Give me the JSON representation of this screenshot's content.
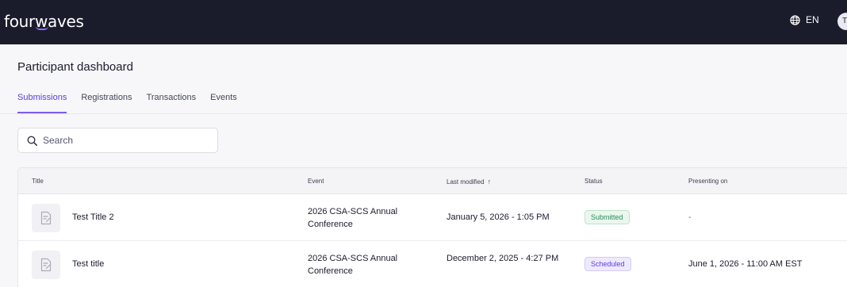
{
  "app": {
    "logo_prefix": "four",
    "logo_w": "w",
    "logo_suffix": "aves",
    "language": "EN",
    "avatar_initial": "T",
    "accent_color": "#7c5cf0",
    "topbar_color": "#1b1c2b"
  },
  "page": {
    "title": "Participant dashboard"
  },
  "tabs": [
    {
      "label": "Submissions",
      "active": true
    },
    {
      "label": "Registrations",
      "active": false
    },
    {
      "label": "Transactions",
      "active": false
    },
    {
      "label": "Events",
      "active": false
    }
  ],
  "search": {
    "placeholder": "Search",
    "value": "",
    "icon": "search-icon"
  },
  "table": {
    "columns": [
      "Title",
      "Event",
      "Last modified",
      "Status",
      "Presenting on"
    ],
    "sort_indicator": "↑",
    "rows": [
      {
        "icon": "document-icon",
        "title": "Test Title 2",
        "event": "2026 CSA-SCS Annual Conference",
        "last_modified": "January 5, 2026 - 1:05 PM",
        "status": "Submitted",
        "presenting_on": "-"
      },
      {
        "icon": "document-icon",
        "title": "Test title",
        "event": "2026 CSA-SCS Annual Conference",
        "last_modified": "December 2, 2025 - 4:27 PM",
        "status": "Scheduled",
        "presenting_on": "June 1, 2026 - 11:00 AM EST"
      }
    ]
  },
  "status_colors": {
    "submitted": "#2e8b57",
    "scheduled": "#5b3ee0"
  }
}
